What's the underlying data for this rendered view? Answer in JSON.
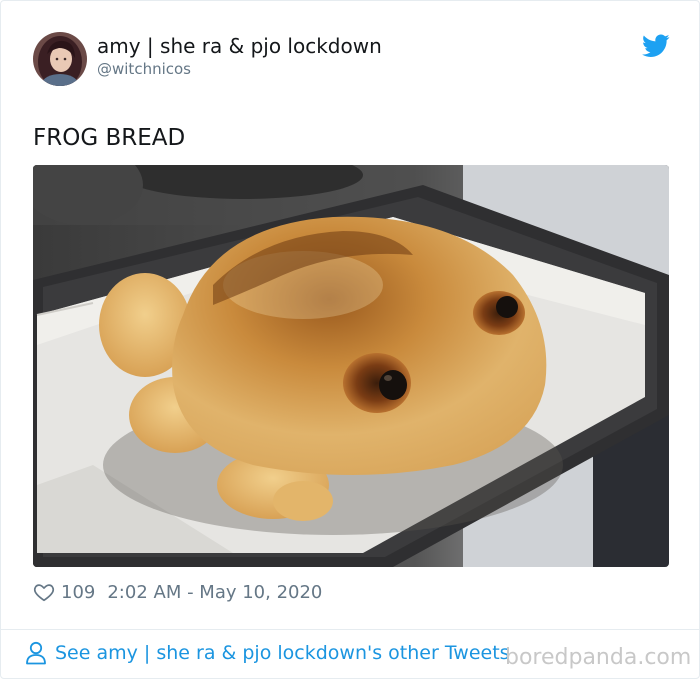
{
  "tweet": {
    "display_name": "amy | she ra & pjo lockdown",
    "handle": "@witchnicos",
    "text": "FROG BREAD",
    "likes": "109",
    "timestamp": "2:02 AM - May 10, 2020",
    "see_more": "See amy | she ra & pjo lockdown's other Tweets"
  },
  "watermark": "boredpanda.com",
  "icons": {
    "brand": "twitter-bird-icon",
    "like": "heart-icon",
    "profile": "person-icon"
  },
  "colors": {
    "twitter_blue": "#1da1f2",
    "link_blue": "#1b95e0",
    "secondary_text": "#657786",
    "primary_text": "#14171a"
  }
}
